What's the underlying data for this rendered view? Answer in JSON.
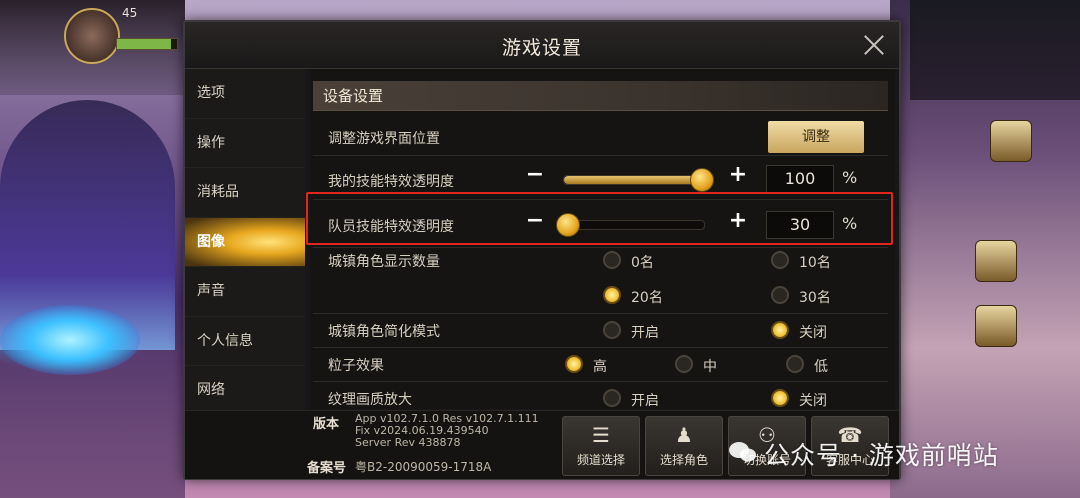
{
  "dialog": {
    "title": "游戏设置"
  },
  "nav": {
    "items": [
      {
        "label": "选项"
      },
      {
        "label": "操作"
      },
      {
        "label": "消耗品"
      },
      {
        "label": "图像"
      },
      {
        "label": "声音"
      },
      {
        "label": "个人信息"
      },
      {
        "label": "网络"
      }
    ],
    "active": "图像"
  },
  "device_settings": {
    "section_title": "设备设置",
    "adjust_ui": {
      "label": "调整游戏界面位置",
      "button": "调整"
    },
    "my_skill_opacity": {
      "label": "我的技能特效透明度",
      "minus": "−",
      "plus": "+",
      "value": "100",
      "level": 1.0,
      "unit": "%"
    },
    "team_skill_opacity": {
      "label": "队员技能特效透明度",
      "minus": "−",
      "plus": "+",
      "value": "30",
      "level": 0.0,
      "unit": "%"
    },
    "town_char_count": {
      "label": "城镇角色显示数量",
      "options": [
        "0名",
        "10名",
        "20名",
        "30名"
      ],
      "selected": "20名"
    },
    "town_char_simplify": {
      "label": "城镇角色简化模式",
      "options": [
        "开启",
        "关闭"
      ],
      "selected": "关闭"
    },
    "particle": {
      "label": "粒子效果",
      "options": [
        "高",
        "中",
        "低"
      ],
      "selected": "高"
    },
    "texture_zoom": {
      "label": "纹理画质放大",
      "options": [
        "开启",
        "关闭"
      ],
      "selected": "关闭"
    }
  },
  "footer": {
    "version_label": "版本",
    "version_lines": "App v102.7.1.0 Res v102.7.1.111\nFix v2024.06.19.439540\nServer Rev 438878",
    "record_label": "备案号",
    "record_value": "粤B2-20090059-1718A",
    "buttons": [
      {
        "label": "频道选择",
        "icon": "list-icon"
      },
      {
        "label": "选择角色",
        "icon": "character-icon"
      },
      {
        "label": "切换账号",
        "icon": "users-icon"
      },
      {
        "label": "客服中心",
        "icon": "support-icon"
      }
    ]
  },
  "hud": {
    "level": "45"
  },
  "watermark": {
    "text": "公众号 · 游戏前哨站"
  },
  "colors": {
    "accent": "#e7a71e",
    "highlight_border": "#e2261f",
    "button_gold": "#d9bc7c"
  }
}
